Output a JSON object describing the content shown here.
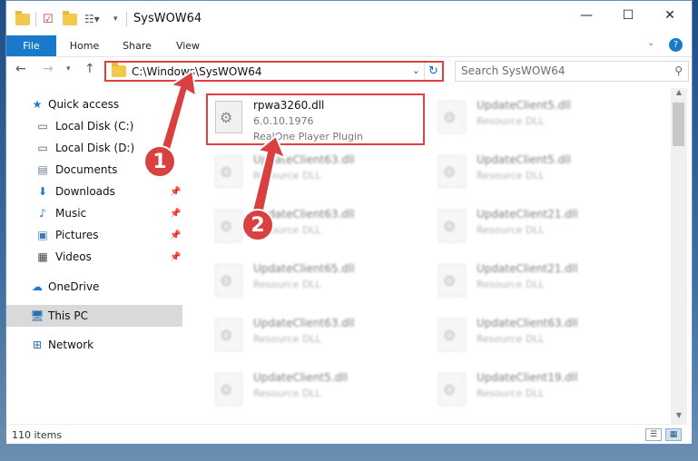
{
  "window": {
    "title": "SysWOW64"
  },
  "ribbon": {
    "tabs": [
      "File",
      "Home",
      "Share",
      "View"
    ]
  },
  "address": {
    "path": "C:\\Windows\\SysWOW64"
  },
  "search": {
    "placeholder": "Search SysWOW64"
  },
  "sidebar": {
    "items": [
      {
        "label": "Quick access",
        "icon": "star-icon"
      },
      {
        "label": "Local Disk (C:)",
        "icon": "drive-icon"
      },
      {
        "label": "Local Disk (D:)",
        "icon": "drive-icon"
      },
      {
        "label": "Documents",
        "icon": "documents-icon"
      },
      {
        "label": "Downloads",
        "icon": "download-icon"
      },
      {
        "label": "Music",
        "icon": "music-icon"
      },
      {
        "label": "Pictures",
        "icon": "pictures-icon"
      },
      {
        "label": "Videos",
        "icon": "videos-icon"
      },
      {
        "label": "OneDrive",
        "icon": "cloud-icon"
      },
      {
        "label": "This PC",
        "icon": "computer-icon"
      },
      {
        "label": "Network",
        "icon": "network-icon"
      }
    ]
  },
  "files": {
    "highlighted": {
      "name": "rpwa3260.dll",
      "version": "6.0.10.1976",
      "description": "RealOne Player Plugin"
    },
    "left": [
      {
        "name": "UpdateClient63.dll",
        "type": "Resource DLL"
      },
      {
        "name": "UpdateClient63.dll",
        "type": "Resource DLL"
      },
      {
        "name": "UpdateClient65.dll",
        "type": "Resource DLL"
      },
      {
        "name": "UpdateClient63.dll",
        "type": "Resource DLL"
      },
      {
        "name": "UpdateClient5.dll",
        "type": "Resource DLL"
      }
    ],
    "right": [
      {
        "name": "UpdateClient5.dll",
        "type": "Resource DLL"
      },
      {
        "name": "UpdateClient5.dll",
        "type": "Resource DLL"
      },
      {
        "name": "UpdateClient21.dll",
        "type": "Resource DLL"
      },
      {
        "name": "UpdateClient21.dll",
        "type": "Resource DLL"
      },
      {
        "name": "UpdateClient63.dll",
        "type": "Resource DLL"
      },
      {
        "name": "UpdateClient19.dll",
        "type": "Resource DLL"
      }
    ]
  },
  "status": {
    "count": "110 items"
  },
  "callouts": {
    "one": "1",
    "two": "2"
  },
  "colors": {
    "accent": "#1979ca",
    "highlight": "#e04040",
    "callout": "#d94040"
  }
}
